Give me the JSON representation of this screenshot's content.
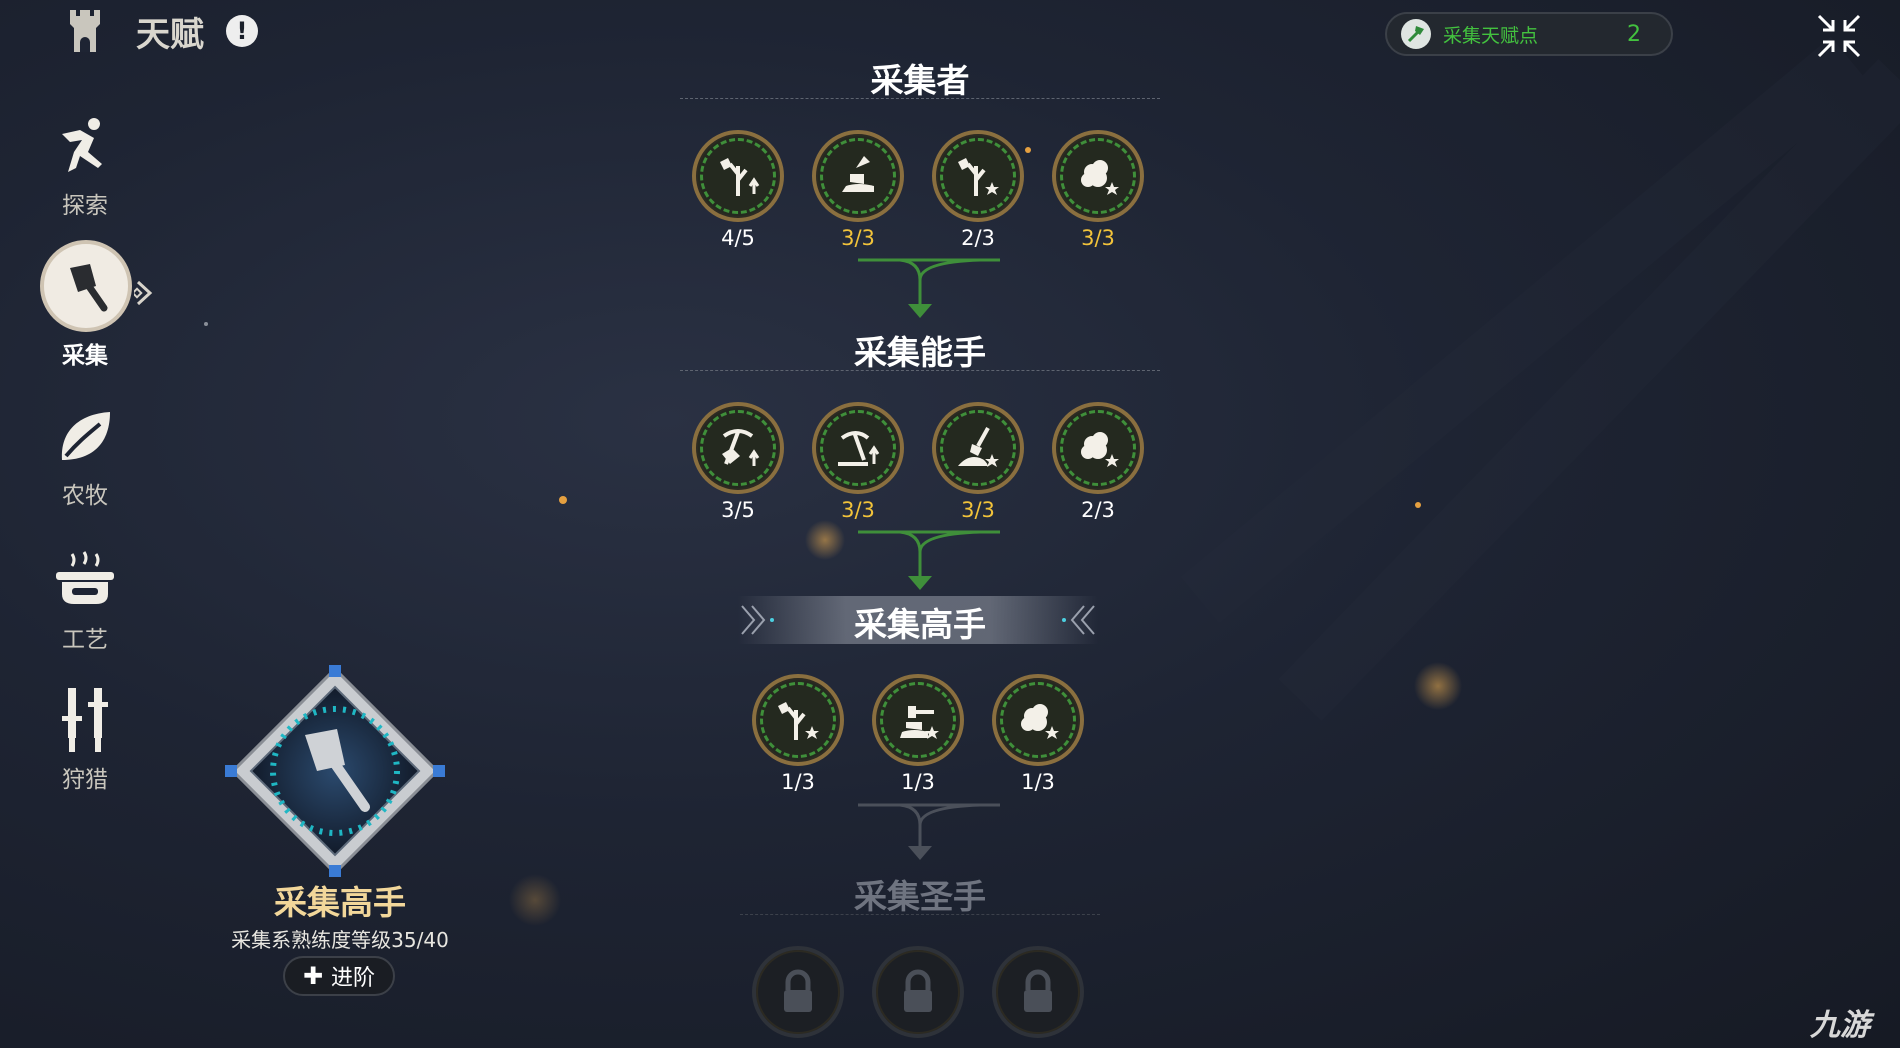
{
  "header": {
    "title": "天赋",
    "tower_icon": "castle-tower-icon",
    "alert_icon": "exclamation-icon"
  },
  "talent_points": {
    "label": "采集天赋点",
    "value": "2",
    "icon": "gather-axe-icon"
  },
  "close_icon": "collapse-arrows-icon",
  "sidebar": {
    "items": [
      {
        "label": "探索",
        "icon": "runner-icon",
        "active": false
      },
      {
        "label": "采集",
        "icon": "axe-icon",
        "active": true
      },
      {
        "label": "农牧",
        "icon": "leaf-icon",
        "active": false
      },
      {
        "label": "工艺",
        "icon": "cooking-pot-icon",
        "active": false
      },
      {
        "label": "狩猎",
        "icon": "crossed-swords-icon",
        "active": false
      }
    ]
  },
  "tiers": [
    {
      "title": "采集者",
      "nodes": [
        {
          "icon": "tree-axe-up-icon",
          "count": "4/5",
          "maxed": false
        },
        {
          "icon": "stump-axe-icon",
          "count": "3/3",
          "maxed": true
        },
        {
          "icon": "tree-axe-star-icon",
          "count": "2/3",
          "maxed": false
        },
        {
          "icon": "cotton-star-icon",
          "count": "3/3",
          "maxed": true
        }
      ]
    },
    {
      "title": "采集能手",
      "nodes": [
        {
          "icon": "pickaxe-ore-up-icon",
          "count": "3/5",
          "maxed": false
        },
        {
          "icon": "pickaxe-rock-up-icon",
          "count": "3/3",
          "maxed": true
        },
        {
          "icon": "shovel-dirt-star-icon",
          "count": "3/3",
          "maxed": true
        },
        {
          "icon": "cotton-star-icon",
          "count": "2/3",
          "maxed": false
        }
      ]
    },
    {
      "title": "采集高手",
      "nodes": [
        {
          "icon": "tree-axe-star-icon",
          "count": "1/3",
          "maxed": false
        },
        {
          "icon": "stump-sledge-star-icon",
          "count": "1/3",
          "maxed": false
        },
        {
          "icon": "cotton-star-icon",
          "count": "1/3",
          "maxed": false
        }
      ]
    },
    {
      "title": "采集圣手",
      "locked": true,
      "nodes": [
        {
          "icon": "padlock-icon"
        },
        {
          "icon": "padlock-icon"
        },
        {
          "icon": "padlock-icon"
        }
      ]
    }
  ],
  "rank": {
    "name": "采集高手",
    "level_text": "采集系熟练度等级35/40",
    "advance_label": "进阶"
  },
  "watermark": "九游",
  "colors": {
    "green": "#43c23f",
    "gold": "#f2c33a",
    "node_border": "#8a6f3f"
  }
}
